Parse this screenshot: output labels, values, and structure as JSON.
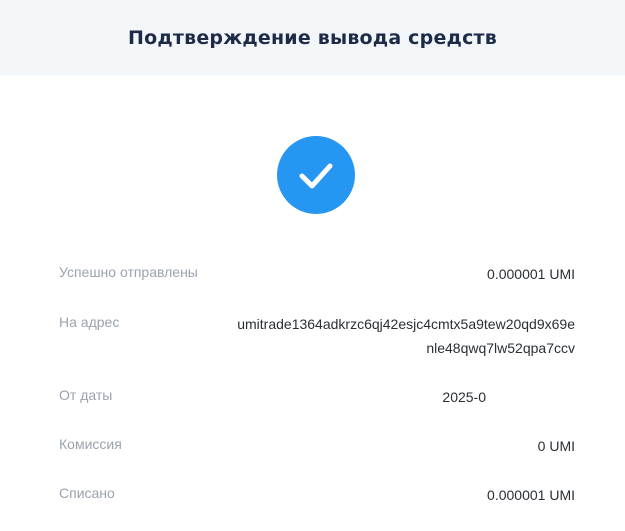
{
  "header": {
    "title": "Подтверждение вывода средств"
  },
  "status": {
    "icon": "checkmark-icon",
    "color": "#2596f2"
  },
  "details": [
    {
      "label": "Успешно отправлены",
      "value": "0.000001 UMI"
    },
    {
      "label": "На адрес",
      "value": "umitrade1364adkrzc6qj42esjc4cmtx5a9tew20qd9x69enle48qwq7lw52qpa7ccv"
    },
    {
      "label": "От даты",
      "value": "2025-0"
    },
    {
      "label": "Комиссия",
      "value": "0 UMI"
    },
    {
      "label": "Списано",
      "value": "0.000001 UMI"
    }
  ]
}
